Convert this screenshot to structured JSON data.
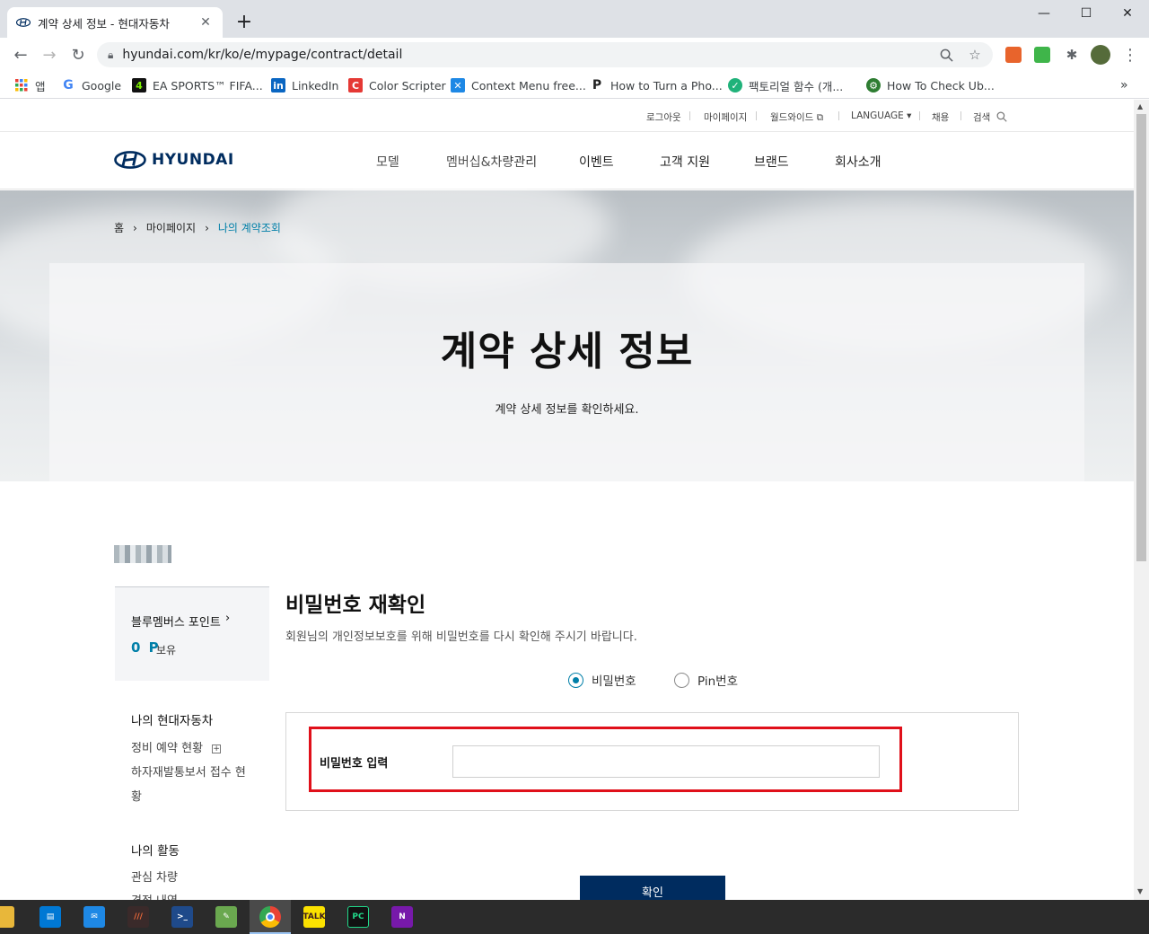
{
  "browser": {
    "tab_title": "계약 상세 정보 - 현대자동차",
    "url": "hyundai.com/kr/ko/e/mypage/contract/detail",
    "bookmarks": [
      {
        "label": "앱",
        "icon": "apps-grid-icon"
      },
      {
        "label": "Google",
        "icon": "google-icon"
      },
      {
        "label": "EA SPORTS™ FIFA...",
        "icon": "fifa-icon"
      },
      {
        "label": "LinkedIn",
        "icon": "linkedin-icon"
      },
      {
        "label": "Color Scripter",
        "icon": "color-scripter-icon"
      },
      {
        "label": "Context Menu free...",
        "icon": "context-menu-icon"
      },
      {
        "label": "How to Turn a Pho...",
        "icon": "p-icon"
      },
      {
        "label": "팩토리얼 함수 (개...",
        "icon": "factorial-icon"
      },
      {
        "label": "How To Check Ub...",
        "icon": "ubuntu-icon"
      }
    ]
  },
  "util_nav": {
    "logout": "로그아웃",
    "mypage": "마이페이지",
    "worldwide": "월드와이드",
    "language": "LANGUAGE",
    "recruit": "채용",
    "search": "검색"
  },
  "gnb": {
    "logo": "HYUNDAI",
    "menus": [
      "모델",
      "멤버십&차량관리",
      "이벤트",
      "고객 지원",
      "브랜드",
      "회사소개"
    ]
  },
  "breadcrumb": {
    "home": "홈",
    "mypage": "마이페이지",
    "current": "나의 계약조회"
  },
  "hero": {
    "title": "계약 상세 정보",
    "subtitle": "계약 상세 정보를 확인하세요."
  },
  "sidebar": {
    "points_label": "블루멤버스 포인트",
    "points_value": "0 P",
    "points_unit": "보유",
    "section1_title": "나의 현대자동차",
    "section1_items": [
      "정비 예약 현황",
      "하자재발통보서 접수 현",
      "황"
    ],
    "section2_title": "나의 활동",
    "section2_items": [
      "관심 차량",
      "견적 내역"
    ]
  },
  "main": {
    "title": "비밀번호 재확인",
    "description": "회원님의 개인정보보호를 위해 비밀번호를 다시 확인해 주시기 바랍니다.",
    "radio_password": "비밀번호",
    "radio_pin": "Pin번호",
    "selected_auth": "비밀번호",
    "password_label": "비밀번호 입력",
    "password_value": "",
    "confirm_label": "확인"
  },
  "colors": {
    "brand_navy": "#002c5f",
    "accent_teal": "#007fa8",
    "highlight_red": "#e0101a"
  }
}
